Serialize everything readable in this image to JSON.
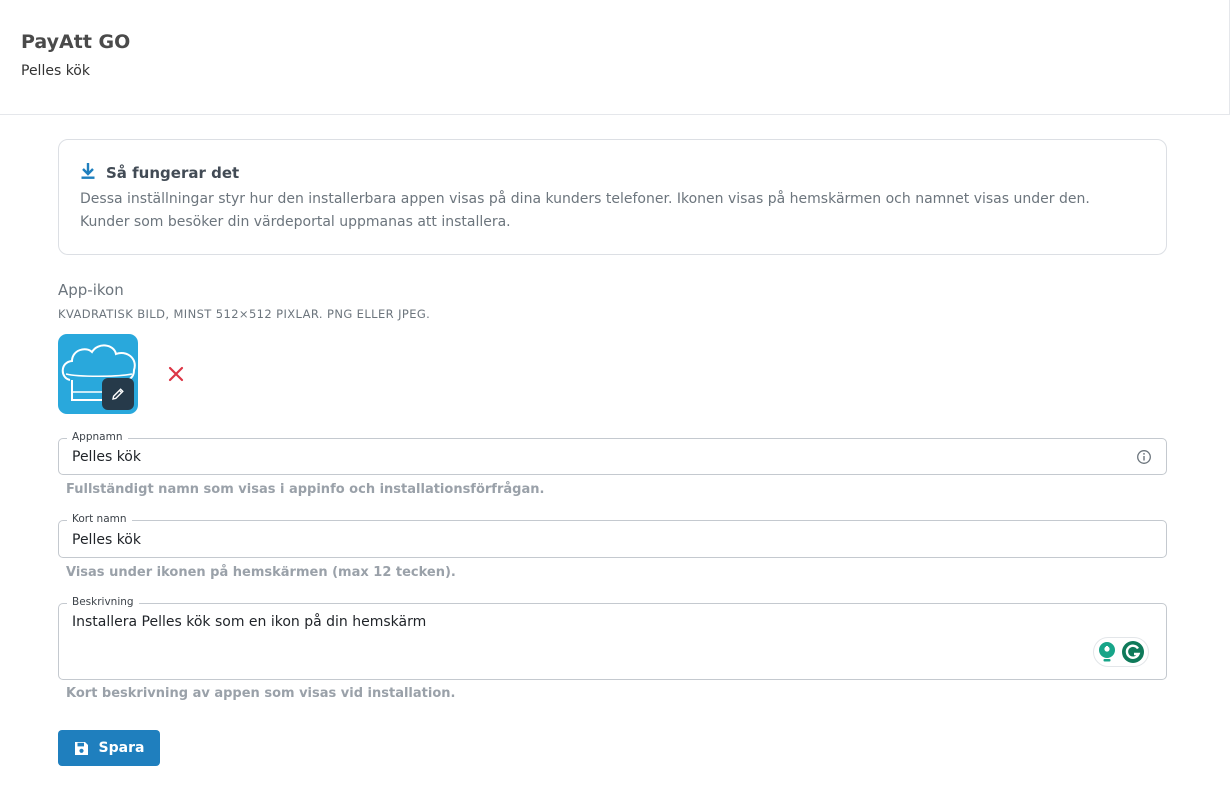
{
  "header": {
    "app_title": "PayAtt GO",
    "shop_name": "Pelles kök"
  },
  "info": {
    "icon": "download-icon",
    "title": "Så fungerar det",
    "text": "Dessa inställningar styr hur den installerbara appen visas på dina kunders telefoner. Ikonen visas på hemskärmen och namnet visas under den. Kunder som besöker din värdeportal uppmanas att installera."
  },
  "app_icon": {
    "label": "App-ikon",
    "hint": "KVADRATISK BILD, MINST 512×512 PIXLAR. PNG ELLER JPEG.",
    "image_icon": "chef-hat-icon",
    "edit_icon": "pencil-icon",
    "remove_icon": "close-icon",
    "remove_color": "#dc3545"
  },
  "fields": {
    "app_name": {
      "label": "Appnamn",
      "value": "Pelles kök",
      "helper": "Fullständigt namn som visas i appinfo och installationsförfrågan."
    },
    "short_name": {
      "label": "Kort namn",
      "value": "Pelles kök",
      "helper": "Visas under ikonen på hemskärmen (max 12 tecken)."
    },
    "description": {
      "label": "Beskrivning",
      "value": "Installera Pelles kök som en ikon på din hemskärm",
      "helper": "Kort beskrivning av appen som visas vid installation."
    }
  },
  "save_button": {
    "label": "Spara",
    "icon": "floppy-disk-icon",
    "color": "#1f7fbe"
  },
  "colors": {
    "accent": "#1f7fbe",
    "icon_bg": "#29a8dc"
  }
}
